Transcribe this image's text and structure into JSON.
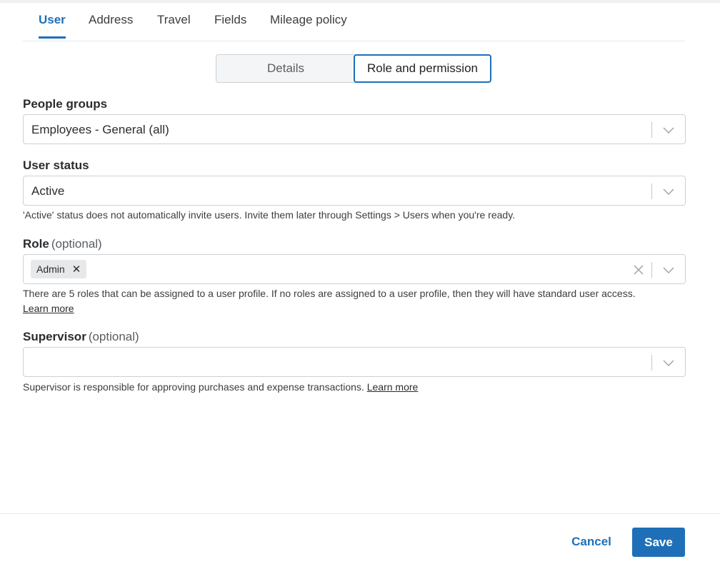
{
  "tabs": [
    {
      "label": "User",
      "active": true
    },
    {
      "label": "Address",
      "active": false
    },
    {
      "label": "Travel",
      "active": false
    },
    {
      "label": "Fields",
      "active": false
    },
    {
      "label": "Mileage policy",
      "active": false
    }
  ],
  "segmented": {
    "details_label": "Details",
    "role_label": "Role and permission",
    "selected": "Role and permission"
  },
  "people_groups": {
    "label": "People groups",
    "value": "Employees - General (all)"
  },
  "user_status": {
    "label": "User status",
    "value": "Active",
    "help": "'Active' status does not automatically invite users. Invite them later through Settings > Users when you're ready."
  },
  "role": {
    "label": "Role",
    "optional": "(optional)",
    "chips": [
      "Admin"
    ],
    "help": "There are 5 roles that can be assigned to a user profile. If no roles are assigned to a user profile, then they will have standard user access.",
    "learn_more": "Learn more"
  },
  "supervisor": {
    "label": "Supervisor",
    "optional": "(optional)",
    "value": "",
    "help": "Supervisor is responsible for approving purchases and expense transactions.",
    "learn_more": "Learn more"
  },
  "footer": {
    "cancel_label": "Cancel",
    "save_label": "Save"
  },
  "colors": {
    "accent": "#1f6fb8",
    "border": "#cdd1d5",
    "text": "#2a2c2f"
  },
  "icons": {
    "chevron": "chevron-down-icon",
    "clear": "close-icon"
  }
}
